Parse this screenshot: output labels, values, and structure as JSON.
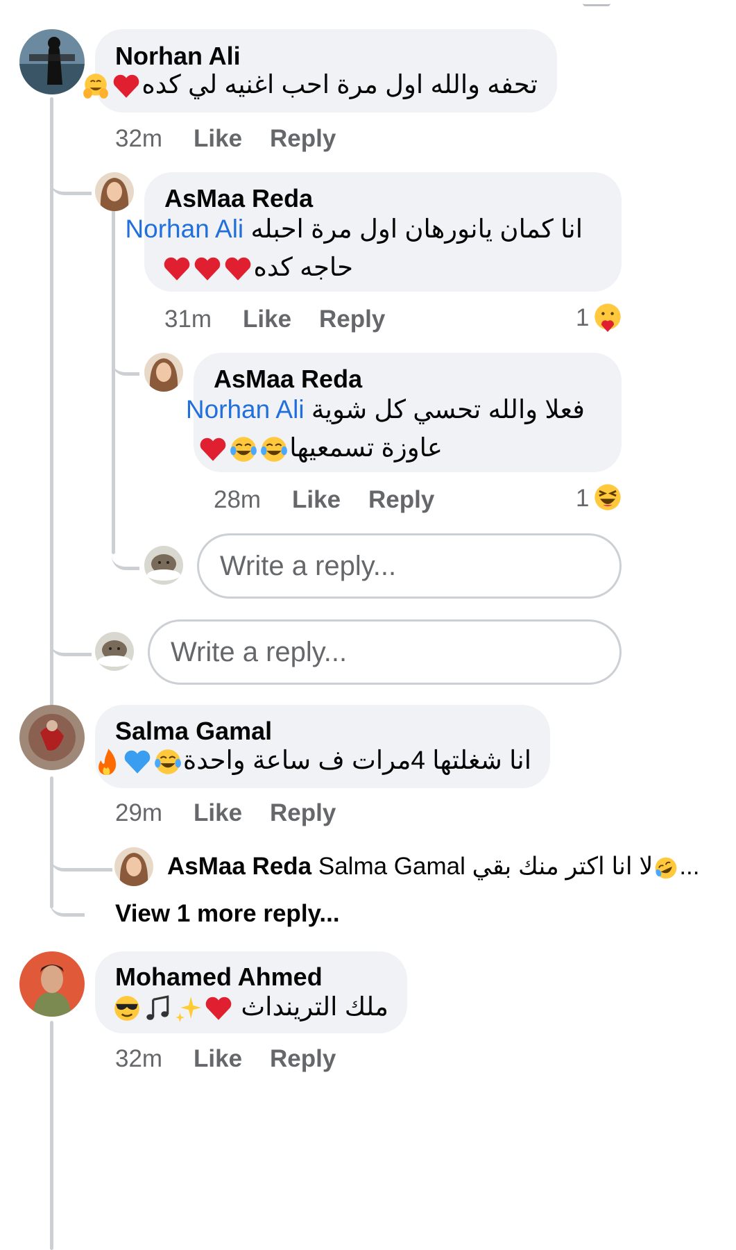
{
  "comments": [
    {
      "author": "Norhan Ali",
      "text": "تحفه والله اول مرة احب اغنيه لي كده",
      "emojis": [
        "red-heart",
        "hugging-face"
      ],
      "time": "32m",
      "like": "Like",
      "reply": "Reply",
      "replies": [
        {
          "author": "AsMaa Reda",
          "mention": "Norhan Ali",
          "line1": "انا كمان يانورهان اول مرة احبله",
          "line2": "حاجه كده",
          "emojis": [
            "red-heart",
            "red-heart",
            "red-heart"
          ],
          "time": "31m",
          "like": "Like",
          "reply": "Reply",
          "reaction_count": "1",
          "reaction": "face-holding-heart"
        },
        {
          "author": "AsMaa Reda",
          "mention": "Norhan Ali",
          "line1": "فعلا والله تحسي كل شوية",
          "line2": "عاوزة تسمعيها",
          "emojis": [
            "red-heart",
            "tears-of-joy",
            "tears-of-joy"
          ],
          "time": "28m",
          "like": "Like",
          "reply": "Reply",
          "reaction_count": "1",
          "reaction": "laughing-squint"
        }
      ],
      "nested_reply_placeholder": "Write a reply...",
      "reply_placeholder": "Write a reply..."
    },
    {
      "author": "Salma Gamal",
      "text": "انا شغلتها 4مرات ف ساعة واحدة",
      "emojis": [
        "tears-of-joy",
        "blue-heart",
        "fire"
      ],
      "time": "29m",
      "like": "Like",
      "reply": "Reply",
      "inline_reply": {
        "author": "AsMaa Reda",
        "mention": "Salma Gamal",
        "text": "لا انا اكتر منك بقي",
        "emoji": "rolling-laughing",
        "ellipsis": "..."
      },
      "view_more": "View 1 more reply..."
    },
    {
      "author": "Mohamed Ahmed",
      "text": "ملك الترينداث",
      "emojis": [
        "red-heart",
        "sparkles",
        "music-notes",
        "sunglasses-face"
      ],
      "time": "32m",
      "like": "Like",
      "reply": "Reply"
    }
  ]
}
